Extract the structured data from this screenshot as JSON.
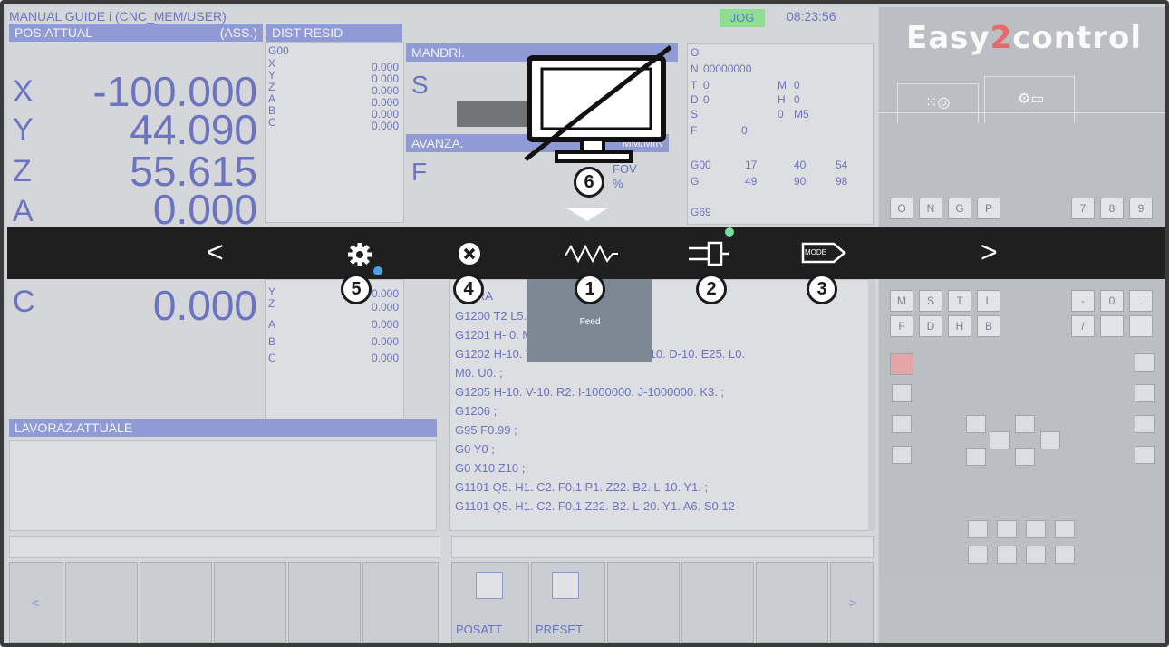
{
  "header": {
    "title": "MANUAL GUIDE i     (CNC_MEM/USER)",
    "mode": "JOG",
    "time": "08:23:56"
  },
  "position": {
    "header": "POS.ATTUAL",
    "header_mode": "(ASS.)",
    "axes": [
      {
        "letter": "X",
        "value": "-100.000"
      },
      {
        "letter": "Y",
        "value": "44.090"
      },
      {
        "letter": "Z",
        "value": "55.615"
      },
      {
        "letter": "A",
        "value": "0.000"
      },
      {
        "letter": "C",
        "value": "0.000"
      }
    ]
  },
  "dist_resid": {
    "header": "DIST RESID",
    "gcode": "G00",
    "rows_top": [
      {
        "axis": "X",
        "value": "0.000"
      },
      {
        "axis": "Y",
        "value": "0.000"
      },
      {
        "axis": "Z",
        "value": "0.000"
      },
      {
        "axis": "A",
        "value": "0.000"
      },
      {
        "axis": "B",
        "value": "0.000"
      },
      {
        "axis": "C",
        "value": "0.000"
      }
    ],
    "rows_bottom": [
      {
        "axis": "Y",
        "value": "0.000"
      },
      {
        "axis": "Z",
        "value": "0.000"
      },
      {
        "axis": "A",
        "value": "0.000"
      },
      {
        "axis": "B",
        "value": "0.000"
      },
      {
        "axis": "C",
        "value": "0.000"
      }
    ]
  },
  "spindle": {
    "header": "MANDRI.",
    "letter": "S",
    "feed_header": "AVANZA.",
    "feed_unit": "MM/MIN",
    "feed_letter": "F",
    "fov": "FOV",
    "fov_pct": "%"
  },
  "modal": {
    "lines": [
      [
        "O",
        "",
        "",
        ""
      ],
      [
        "N",
        "00000000",
        "",
        ""
      ],
      [
        "T",
        "0",
        "M",
        "0"
      ],
      [
        "D",
        "0",
        "H",
        "0"
      ],
      [
        "S",
        "",
        "0",
        "M5"
      ],
      [
        "F",
        "0",
        "",
        ""
      ],
      [
        "G00",
        "17",
        "40",
        "54"
      ],
      [
        "G",
        "49",
        "90",
        "98"
      ],
      [
        "G69",
        "",
        "",
        ""
      ]
    ]
  },
  "program": {
    "lines": [
      "G1200 T2                 L5. A1. ;",
      "G1201 H-                 0. M0. ;",
      "G1202 H-10. V-10. R25. F25. J10. C-10. D-10. E25. L0.",
      "M0. U0. ;",
      "G1205 H-10. V-10. R2. I-1000000. J-1000000. K3. ;",
      "G1206 ;",
      "G95 F0.99 ;",
      "G0 Y0 ;",
      "G0 X10 Z10 ;",
      "G1101 Q5. H1. C2. F0.1 P1. Z22. B2. L-10. Y1. ;",
      "G1101 Q5. H1. C2. F0.1 Z22. B2. L-20. Y1. A6. S0.12"
    ],
    "partial_top": "G GRA"
  },
  "current_work": {
    "header": "LAVORAZ.ATTUALE"
  },
  "softkeys": {
    "left_arrow": "<",
    "right_arrow": ">",
    "posatt": "POSATT",
    "preset": "PRESET"
  },
  "overlay": {
    "prev": "<",
    "next": ">",
    "feed_label": "Feed",
    "mode_label": "MODE",
    "badges": [
      "1",
      "2",
      "3",
      "4",
      "5",
      "6"
    ]
  },
  "control_panel": {
    "logo_a": "Easy",
    "logo_b": "2",
    "logo_c": "control",
    "keys_row1": [
      "O",
      "N",
      "G",
      "P",
      "7",
      "8",
      "9"
    ],
    "keys_row2": [
      "M",
      "S",
      "T",
      "L",
      "-",
      "0",
      "."
    ],
    "keys_row3": [
      "F",
      "D",
      "H",
      "B",
      "/",
      "",
      ""
    ]
  }
}
